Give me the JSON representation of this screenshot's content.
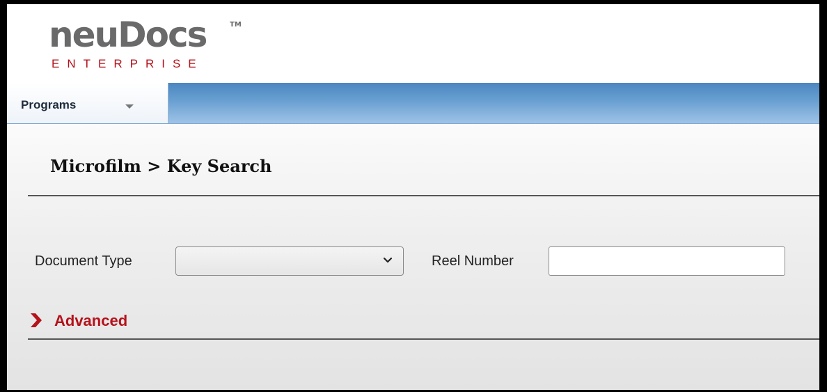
{
  "brand": {
    "logo_main": "neuDocs",
    "logo_tm": "TM",
    "logo_sub": "ENTERPRISE",
    "accent_color": "#b5121b",
    "logo_color": "#6a6a6a"
  },
  "navbar": {
    "programs_label": "Programs",
    "programs_icon": "chevron-down-icon",
    "bar_color": "#5b95cb"
  },
  "page": {
    "title": "Microfilm > Key Search"
  },
  "form": {
    "document_type": {
      "label": "Document Type",
      "value": "",
      "icon": "chevron-down-icon"
    },
    "reel_number": {
      "label": "Reel Number",
      "value": "",
      "placeholder": ""
    }
  },
  "advanced": {
    "label": "Advanced",
    "icon": "chevron-right-icon",
    "color": "#b5121b"
  }
}
